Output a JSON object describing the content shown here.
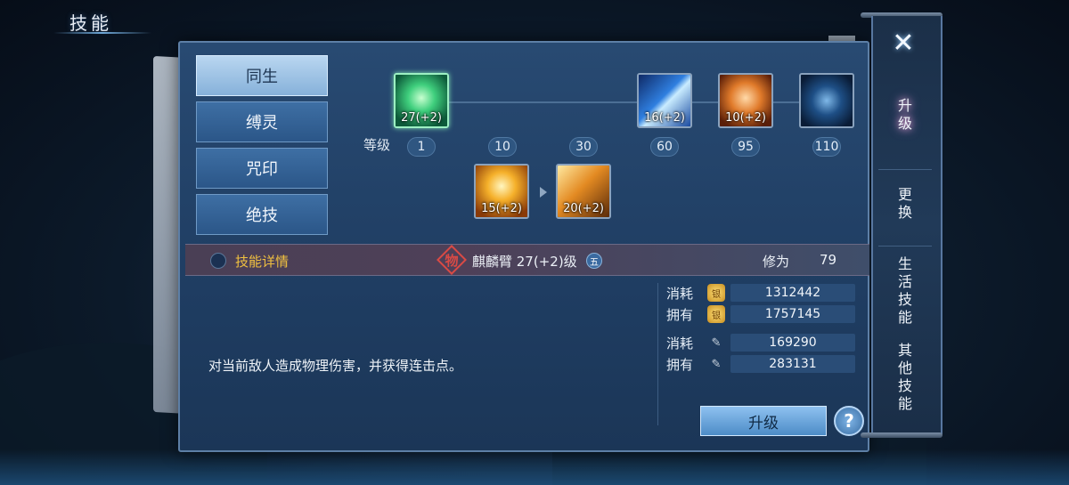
{
  "page_title": "技能",
  "tabs": [
    {
      "label": "同生",
      "active": true
    },
    {
      "label": "缚灵",
      "active": false
    },
    {
      "label": "咒印",
      "active": false
    },
    {
      "label": "绝技",
      "active": false
    }
  ],
  "skill_tree": {
    "level_label": "等级",
    "levels": [
      "1",
      "10",
      "30",
      "60",
      "95",
      "110"
    ],
    "skills": [
      {
        "name": "fist-skill",
        "level_text": "27(+2)",
        "selected": true
      },
      {
        "name": "blade-skill",
        "level_text": "16(+2)",
        "selected": false
      },
      {
        "name": "punch-skill",
        "level_text": "10(+2)",
        "selected": false
      },
      {
        "name": "orb-skill",
        "level_text": "",
        "selected": false
      },
      {
        "name": "burst-skill",
        "level_text": "15(+2)",
        "selected": false
      },
      {
        "name": "slash-skill",
        "level_text": "20(+2)",
        "selected": false
      }
    ]
  },
  "info_bar": {
    "detail_label": "技能详情",
    "badge_char": "物",
    "weapon": "麒麟臂 27(+2)级",
    "grade_icon": "五",
    "xiuwei_label": "修为",
    "xiuwei_value": "79"
  },
  "description": "对当前敌人造成物理伤害，并获得连击点。",
  "resources": [
    {
      "label": "消耗",
      "icon": "gold-coin-icon",
      "value": "1312442"
    },
    {
      "label": "拥有",
      "icon": "gold-coin-icon",
      "value": "1757145"
    },
    {
      "label": "消耗",
      "icon": "scroll-icon",
      "value": "169290"
    },
    {
      "label": "拥有",
      "icon": "scroll-icon",
      "value": "283131"
    }
  ],
  "gold_icon_text": "银",
  "scroll_icon_text": "✎",
  "upgrade_button": "升级",
  "help_button": "?",
  "side_menu": {
    "close": "✕",
    "items": [
      {
        "label": "升级",
        "active": true
      },
      {
        "label": "更换",
        "active": false
      },
      {
        "label": "生活技能",
        "active": false
      },
      {
        "label": "其他技能",
        "active": false
      }
    ]
  }
}
